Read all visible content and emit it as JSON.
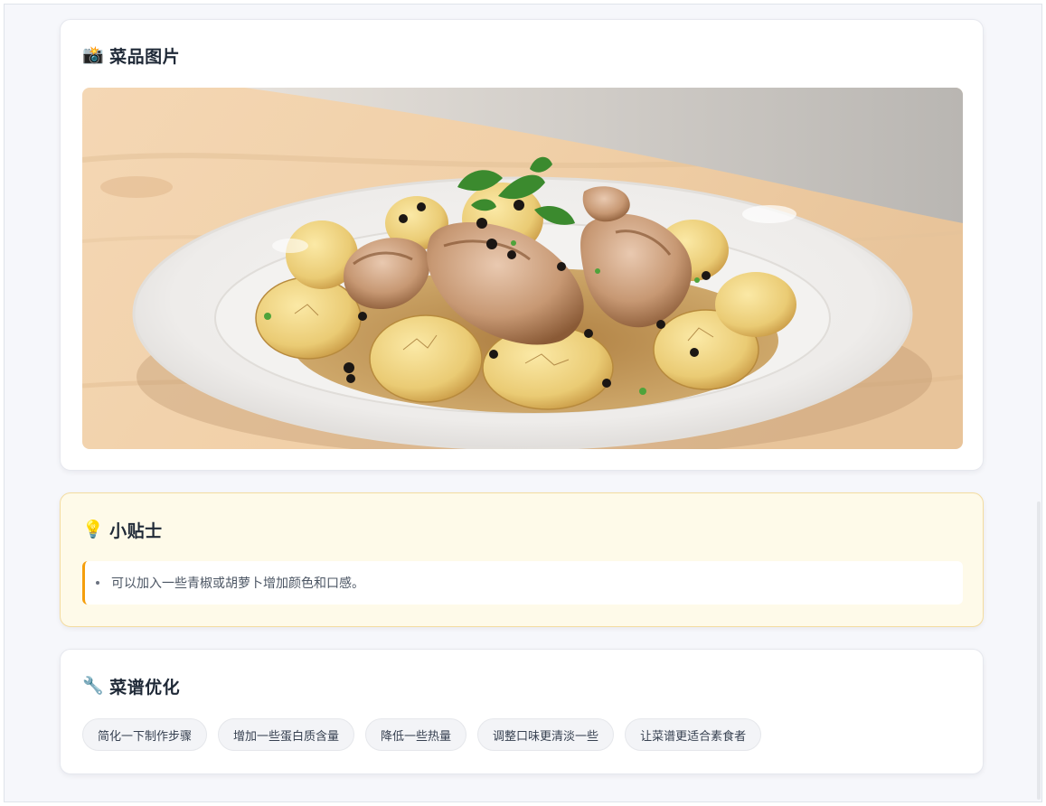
{
  "photo_section": {
    "icon": "camera-icon",
    "icon_glyph": "📸",
    "title": "菜品图片",
    "image_alt": "Dish photo: pan-fried chicken with roasted potatoes and black pepper on a white plate"
  },
  "tips_section": {
    "icon": "lightbulb-icon",
    "icon_glyph": "💡",
    "title": "小贴士",
    "items": [
      "可以加入一些青椒或胡萝卜增加颜色和口感。"
    ]
  },
  "optimize_section": {
    "icon": "wrench-icon",
    "icon_glyph": "🔧",
    "title": "菜谱优化",
    "options": [
      "简化一下制作步骤",
      "增加一些蛋白质含量",
      "降低一些热量",
      "调整口味更清淡一些",
      "让菜谱更适合素食者"
    ]
  },
  "colors": {
    "page_bg": "#f6f7fb",
    "tips_bg": "#fefae9",
    "tips_accent": "#f59e0b",
    "chip_bg": "#f3f4f7"
  }
}
